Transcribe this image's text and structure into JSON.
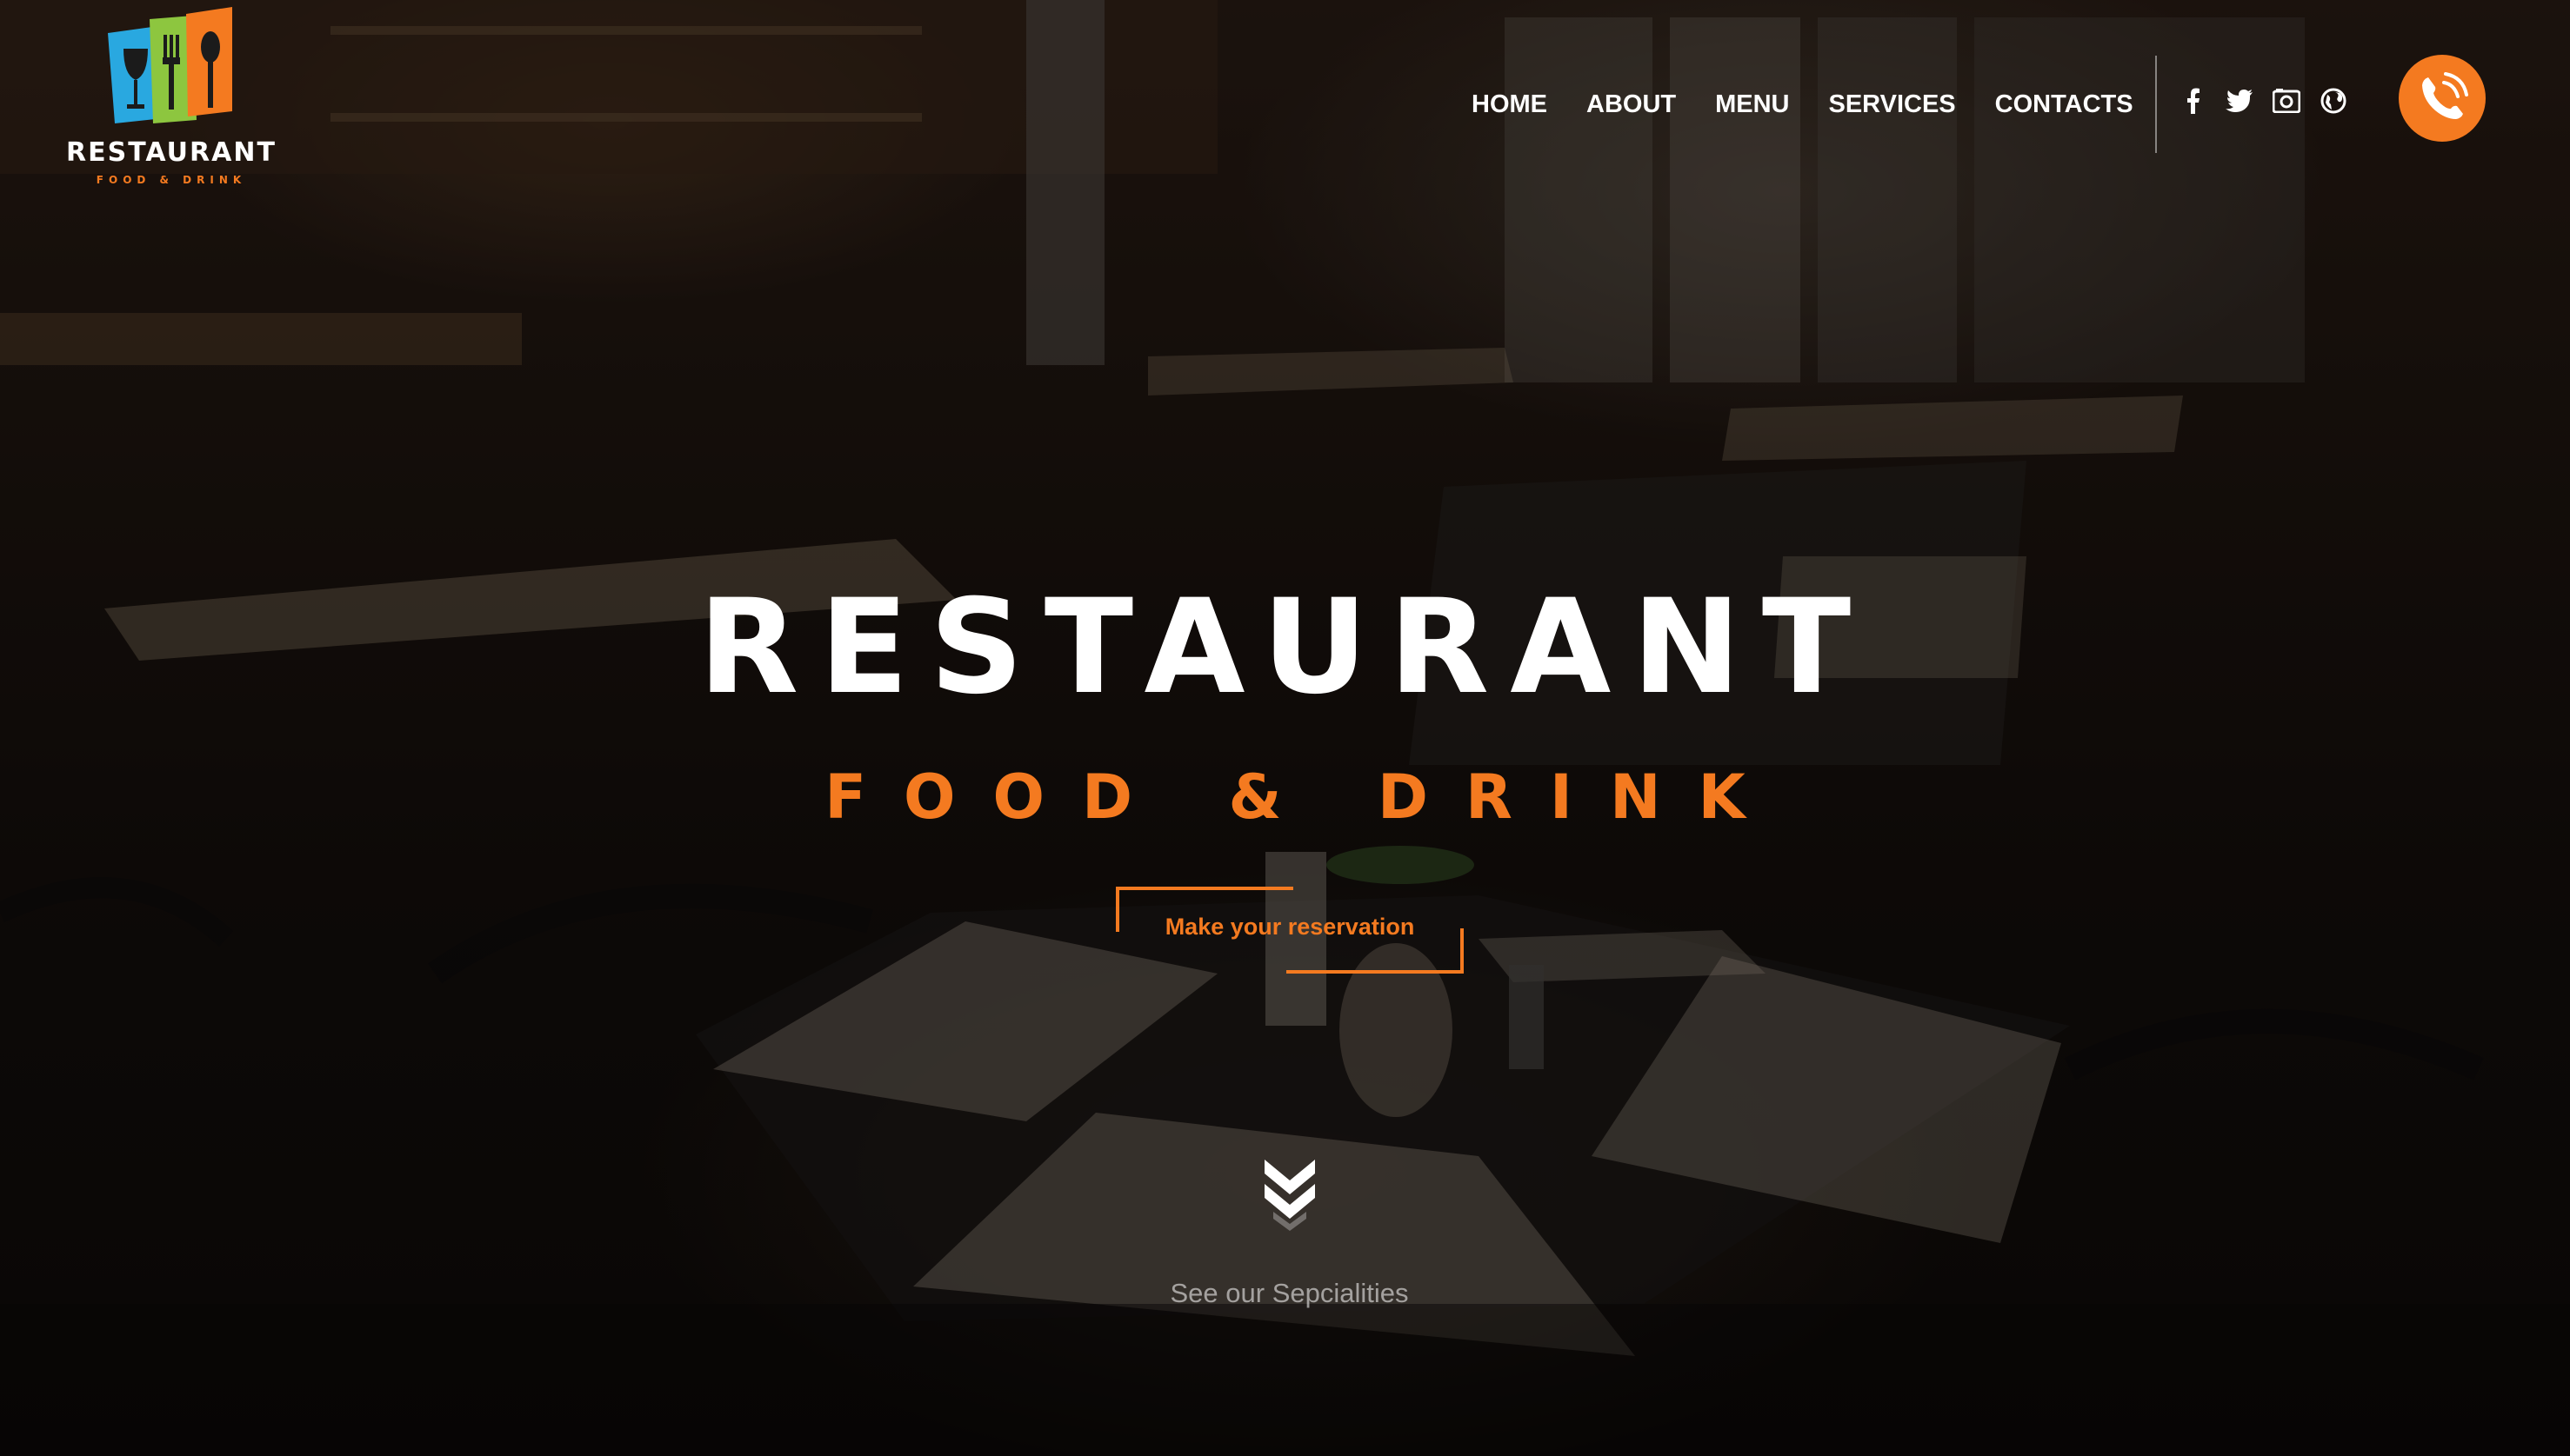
{
  "logo": {
    "name": "RESTAURANT",
    "tagline": "FOOD & DRINK",
    "colors": [
      "#29a8e0",
      "#8dc63f",
      "#f47a20"
    ]
  },
  "nav": {
    "items": [
      "HOME",
      "ABOUT",
      "MENU",
      "SERVICES",
      "CONTACTS"
    ]
  },
  "social": {
    "icons": [
      "facebook-icon",
      "twitter-icon",
      "instagram-icon",
      "globe-icon"
    ]
  },
  "phone": {
    "icon": "phone-icon"
  },
  "hero": {
    "title": "RESTAURANT",
    "subtitle": "FOOD & DRINK",
    "cta_label": "Make your reservation",
    "scroll_label": "See our Sepcialities",
    "scroll_icon": "double-chevron-down-icon"
  },
  "colors": {
    "accent": "#f47a20",
    "text": "#ffffff"
  }
}
